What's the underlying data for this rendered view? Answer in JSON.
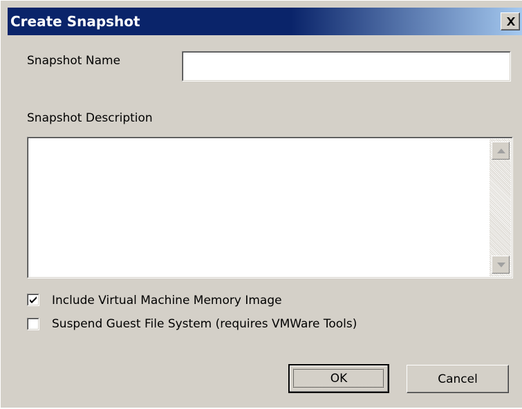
{
  "dialog": {
    "title": "Create Snapshot",
    "close_icon": "close-x-icon"
  },
  "form": {
    "name_label": "Snapshot Name",
    "name_value": "",
    "description_label": "Snapshot Description",
    "description_value": "",
    "include_memory": {
      "label": "Include Virtual Machine Memory Image",
      "checked": true
    },
    "quiesce": {
      "label": "Suspend Guest File System (requires VMWare Tools)",
      "checked": false
    }
  },
  "buttons": {
    "ok_label": "OK",
    "cancel_label": "Cancel"
  },
  "colors": {
    "titlebar_start": "#0a246a",
    "titlebar_end": "#a6caf0",
    "dialog_face": "#d4d0c8"
  }
}
